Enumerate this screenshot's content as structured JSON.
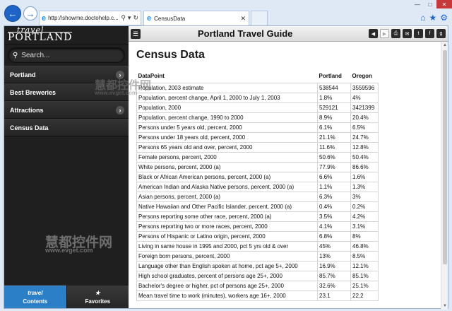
{
  "browser": {
    "address": "http://showme.doctohelp.c...",
    "tab_title": "CensusData",
    "window_controls": [
      "—",
      "□",
      "✕"
    ]
  },
  "sidebar": {
    "logo_line1": "travel",
    "logo_line2": "PORTLAND",
    "search_placeholder": "Search...",
    "items": [
      {
        "label": "Portland",
        "has_arrow": true
      },
      {
        "label": "Best Breweries",
        "has_arrow": false
      },
      {
        "label": "Attractions",
        "has_arrow": true
      },
      {
        "label": "Census Data",
        "has_arrow": false
      }
    ],
    "bottom_tabs": [
      {
        "label": "Contents",
        "icon": "travel"
      },
      {
        "label": "Favorites",
        "icon": "★"
      }
    ]
  },
  "header": {
    "title": "Portland Travel Guide"
  },
  "content": {
    "heading": "Census Data",
    "table": {
      "headers": [
        "DataPoint",
        "Portland",
        "Oregon"
      ],
      "rows": [
        [
          "Population, 2003 estimate",
          "538544",
          "3559596"
        ],
        [
          "Population, percent change, April 1, 2000 to July 1, 2003",
          "1.8%",
          "4%"
        ],
        [
          "Population, 2000",
          "529121",
          "3421399"
        ],
        [
          "Population, percent change, 1990 to 2000",
          "8.9%",
          "20.4%"
        ],
        [
          "Persons under 5 years old, percent, 2000",
          "6.1%",
          "6.5%"
        ],
        [
          "Persons under 18 years old, percent, 2000",
          "21.1%",
          "24.7%"
        ],
        [
          "Persons 65 years old and over, percent, 2000",
          "11.6%",
          "12.8%"
        ],
        [
          "Female persons, percent, 2000",
          "50.6%",
          "50.4%"
        ],
        [
          "White persons, percent, 2000 (a)",
          "77.9%",
          "86.6%"
        ],
        [
          "Black or African American persons, percent, 2000 (a)",
          "6.6%",
          "1.6%"
        ],
        [
          "American Indian and Alaska Native persons, percent, 2000 (a)",
          "1.1%",
          "1.3%"
        ],
        [
          "Asian persons, percent, 2000 (a)",
          "6.3%",
          "3%"
        ],
        [
          "Native Hawaiian and Other Pacific Islander, percent, 2000 (a)",
          "0.4%",
          "0.2%"
        ],
        [
          "Persons reporting some other race, percent, 2000 (a)",
          "3.5%",
          "4.2%"
        ],
        [
          "Persons reporting two or more races, percent, 2000",
          "4.1%",
          "3.1%"
        ],
        [
          "Persons of Hispanic or Latino origin, percent, 2000",
          "6.8%",
          "8%"
        ],
        [
          "Living in same house in 1995 and 2000, pct 5 yrs old & over",
          "45%",
          "46.8%"
        ],
        [
          "Foreign born persons, percent, 2000",
          "13%",
          "8.5%"
        ],
        [
          "Language other than English spoken at home, pct age 5+, 2000",
          "16.9%",
          "12.1%"
        ],
        [
          "High school graduates, percent of persons age 25+, 2000",
          "85.7%",
          "85.1%"
        ],
        [
          "Bachelor's degree or higher, pct of persons age 25+, 2000",
          "32.6%",
          "25.1%"
        ],
        [
          "Mean travel time to work (minutes), workers age 16+, 2000",
          "23.1",
          "22.2"
        ]
      ]
    }
  },
  "watermark": {
    "text": "慧都控件网",
    "url": "www.evget.com"
  },
  "colors": {
    "accent": "#2a7fc7",
    "sidebar_bg": "#1f1f1f",
    "browser_bg": "#dfe9f5"
  }
}
